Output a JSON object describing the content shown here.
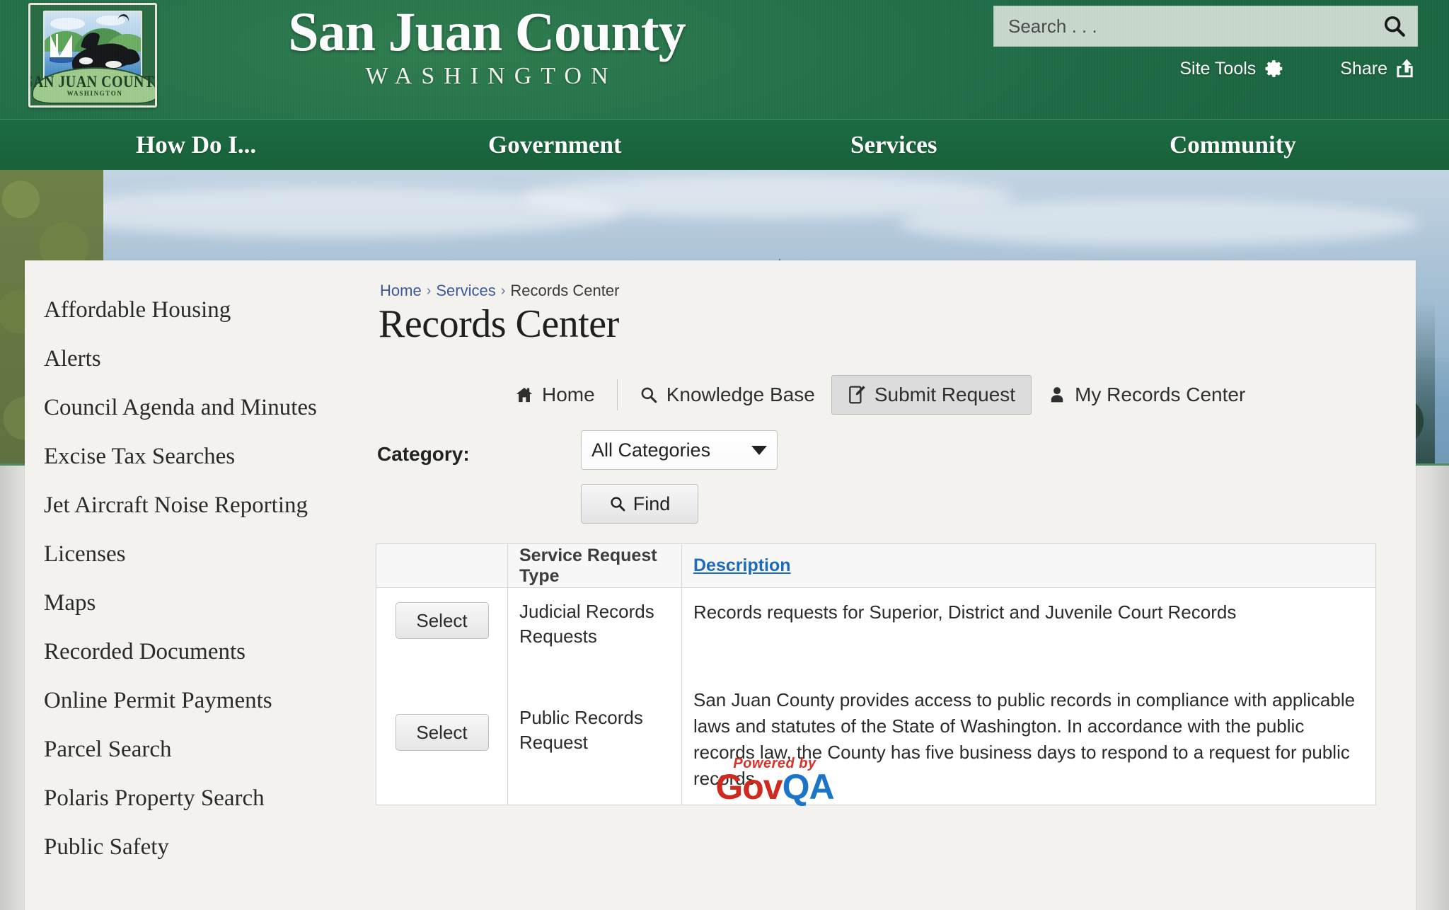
{
  "header": {
    "title_line1": "San Juan County",
    "title_line2": "WASHINGTON",
    "seal": {
      "ribbon_top": "SAN JUAN COUNTY",
      "ribbon_bottom": "WASHINGTON"
    },
    "search": {
      "placeholder": "Search . . .",
      "value": "",
      "icon": "search-icon"
    },
    "site_tools_label": "Site Tools",
    "site_tools_icon": "gear-icon",
    "share_label": "Share",
    "share_icon": "share-icon"
  },
  "nav": {
    "items": [
      {
        "label": "How Do I..."
      },
      {
        "label": "Government"
      },
      {
        "label": "Services"
      },
      {
        "label": "Community"
      }
    ]
  },
  "sidebar": {
    "items": [
      {
        "label": "Affordable Housing"
      },
      {
        "label": "Alerts"
      },
      {
        "label": "Council Agenda and Minutes"
      },
      {
        "label": "Excise Tax Searches"
      },
      {
        "label": "Jet Aircraft Noise Reporting"
      },
      {
        "label": "Licenses"
      },
      {
        "label": "Maps"
      },
      {
        "label": "Recorded Documents"
      },
      {
        "label": "Online Permit Payments"
      },
      {
        "label": "Parcel Search"
      },
      {
        "label": "Polaris Property Search"
      },
      {
        "label": "Public Safety"
      }
    ]
  },
  "breadcrumb": {
    "home": "Home",
    "sep1": "›",
    "services": "Services",
    "sep2": "›",
    "current": "Records Center"
  },
  "page": {
    "title": "Records Center"
  },
  "tabs": [
    {
      "label": "Home",
      "icon": "home-icon",
      "active": false
    },
    {
      "label": "Knowledge Base",
      "icon": "search-icon",
      "active": false
    },
    {
      "label": "Submit Request",
      "icon": "edit-document-icon",
      "active": true
    },
    {
      "label": "My Records Center",
      "icon": "user-icon",
      "active": false
    }
  ],
  "filter": {
    "category_label": "Category:",
    "category_value": "All Categories",
    "category_options": [
      "All Categories"
    ],
    "find_label": "Find",
    "find_icon": "search-icon"
  },
  "table": {
    "headers": {
      "select": "",
      "type": "Service Request Type",
      "description": "Description"
    },
    "rows": [
      {
        "select_label": "Select",
        "type": "Judicial Records Requests",
        "description": "Records requests for Superior, District and Juvenile Court Records"
      },
      {
        "select_label": "Select",
        "type": "Public Records Request",
        "description": "San Juan County provides access to public records in compliance with applicable laws and statutes of the State of Washington. In accordance with the public records law, the County has five business days to respond to a request for public records."
      }
    ]
  },
  "footer": {
    "powered_by": "Powered by",
    "brand_part1": "Gov",
    "brand_part2": "QA"
  },
  "colors": {
    "header_green": "#24724a",
    "nav_green": "#1d6b43",
    "link_blue": "#3c5a99",
    "desc_link_blue": "#1a6bbd",
    "card_bg": "#f3f2ee",
    "govqa_red": "#cf2a20",
    "govqa_blue": "#1b74c7"
  }
}
